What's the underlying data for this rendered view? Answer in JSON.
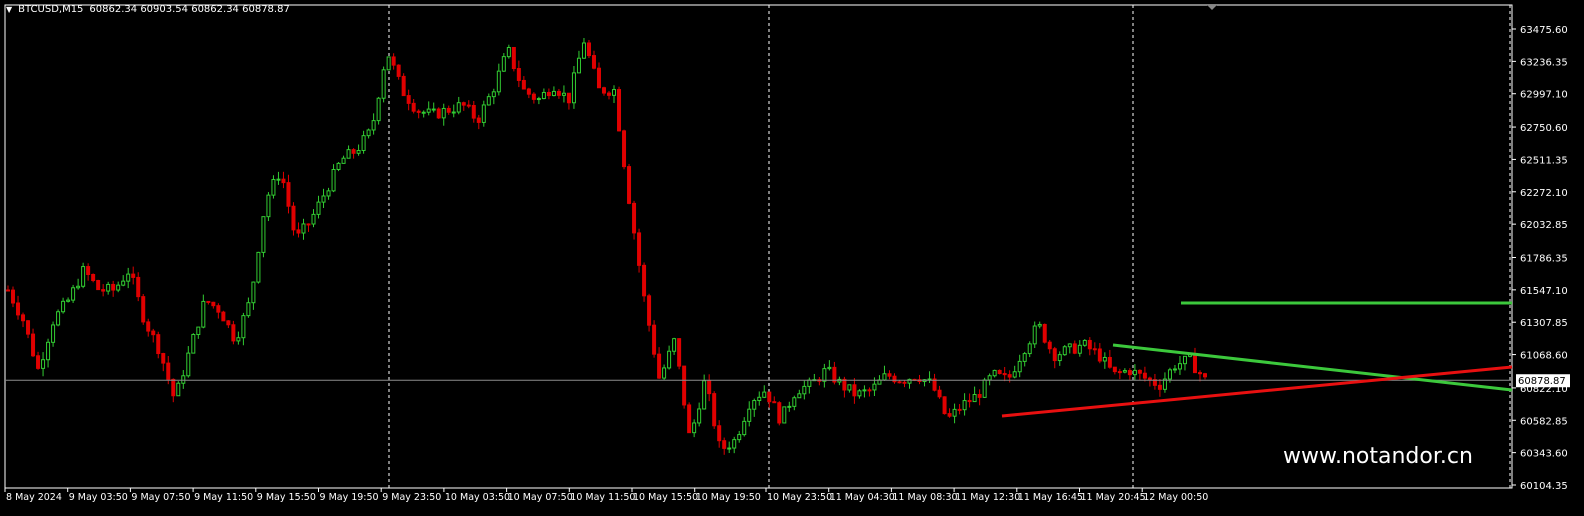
{
  "header": {
    "symbol": "BTCUSD,M15",
    "ohlc": "60862.34 60903.54 60862.34 60878.87"
  },
  "watermark": "www.notandor.cn",
  "colors": {
    "up": "#32cd32",
    "down": "#e00000",
    "bg": "#000000",
    "grid": "#ffffff",
    "bid_line": "#8c8c8c"
  },
  "chart_data": {
    "type": "candlestick",
    "title": "BTCUSD,M15",
    "ylim": [
      60104.35,
      63475.6
    ],
    "y_ticks": [
      "63475.60",
      "63236.35",
      "62997.10",
      "62750.60",
      "62511.35",
      "62272.10",
      "62032.85",
      "61786.35",
      "61547.10",
      "61307.85",
      "61068.60",
      "60822.10",
      "60582.85",
      "60343.60",
      "60104.35"
    ],
    "x_ticks": [
      "8 May 2024",
      "9 May 03:50",
      "9 May 07:50",
      "9 May 11:50",
      "9 May 15:50",
      "9 May 19:50",
      "9 May 23:50",
      "10 May 03:50",
      "10 May 07:50",
      "10 May 11:50",
      "10 May 15:50",
      "10 May 19:50",
      "10 May 23:50",
      "11 May 04:30",
      "11 May 08:30",
      "11 May 12:30",
      "11 May 16:45",
      "11 May 20:45",
      "12 May 00:50"
    ],
    "current_price": "60878.87",
    "price_path": [
      61546,
      61325,
      60955,
      61325,
      61472,
      61694,
      61546,
      61546,
      61694,
      61325,
      61102,
      60733,
      61102,
      61472,
      61398,
      61177,
      61472,
      62211,
      62433,
      61916,
      62064,
      62285,
      62507,
      62581,
      62729,
      63320,
      63025,
      62877,
      62840,
      62877,
      62914,
      62803,
      63025,
      63320,
      63025,
      62951,
      63062,
      62951,
      63394,
      63025,
      63025,
      62211,
      61472,
      60881,
      61177,
      60437,
      60881,
      60363,
      60437,
      60733,
      60807,
      60585,
      60807,
      60844,
      60955,
      60844,
      60770,
      60807,
      60918,
      60881,
      60918,
      60844,
      60585,
      60696,
      60770,
      60918,
      60881,
      61102,
      61288,
      61066,
      61102,
      61140,
      61066,
      60918,
      60955,
      60896,
      60844,
      60991,
      61029,
      60881
    ],
    "horizontal_lines": [
      {
        "price": 61450,
        "color": "green"
      }
    ],
    "trendlines": [
      {
        "from": [
          61135,
          "11 May 20:30"
        ],
        "to": [
          60807,
          "end"
        ],
        "color": "green"
      },
      {
        "from": [
          60663,
          "11 May 12:30"
        ],
        "to": [
          61025,
          "end"
        ],
        "color": "red"
      }
    ]
  }
}
